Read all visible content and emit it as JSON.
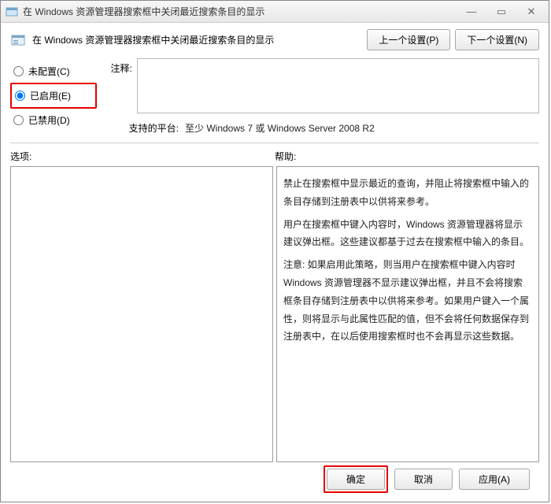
{
  "window": {
    "title": "在 Windows 资源管理器搜索框中关闭最近搜索条目的显示"
  },
  "header": {
    "title": "在 Windows 资源管理器搜索框中关闭最近搜索条目的显示",
    "prev_btn": "上一个设置(P)",
    "next_btn": "下一个设置(N)"
  },
  "radios": {
    "not_configured": "未配置(C)",
    "enabled": "已启用(E)",
    "disabled": "已禁用(D)",
    "selected": "enabled"
  },
  "comment": {
    "label": "注释:",
    "value": ""
  },
  "platform": {
    "label": "支持的平台:",
    "value": "至少 Windows 7 或 Windows Server 2008 R2"
  },
  "cols": {
    "options_label": "选项:",
    "help_label": "帮助:"
  },
  "help": {
    "p1": "禁止在搜索框中显示最近的查询，并阻止将搜索框中输入的条目存储到注册表中以供将来参考。",
    "p2": "用户在搜索框中键入内容时，Windows 资源管理器将显示建议弹出框。这些建议都基于过去在搜索框中输入的条目。",
    "p3": "注意: 如果启用此策略，则当用户在搜索框中键入内容时 Windows 资源管理器不显示建议弹出框，并且不会将搜索框条目存储到注册表中以供将来参考。如果用户键入一个属性，则将显示与此属性匹配的值，但不会将任何数据保存到注册表中，在以后使用搜索框时也不会再显示这些数据。"
  },
  "footer": {
    "ok": "确定",
    "cancel": "取消",
    "apply": "应用(A)"
  }
}
